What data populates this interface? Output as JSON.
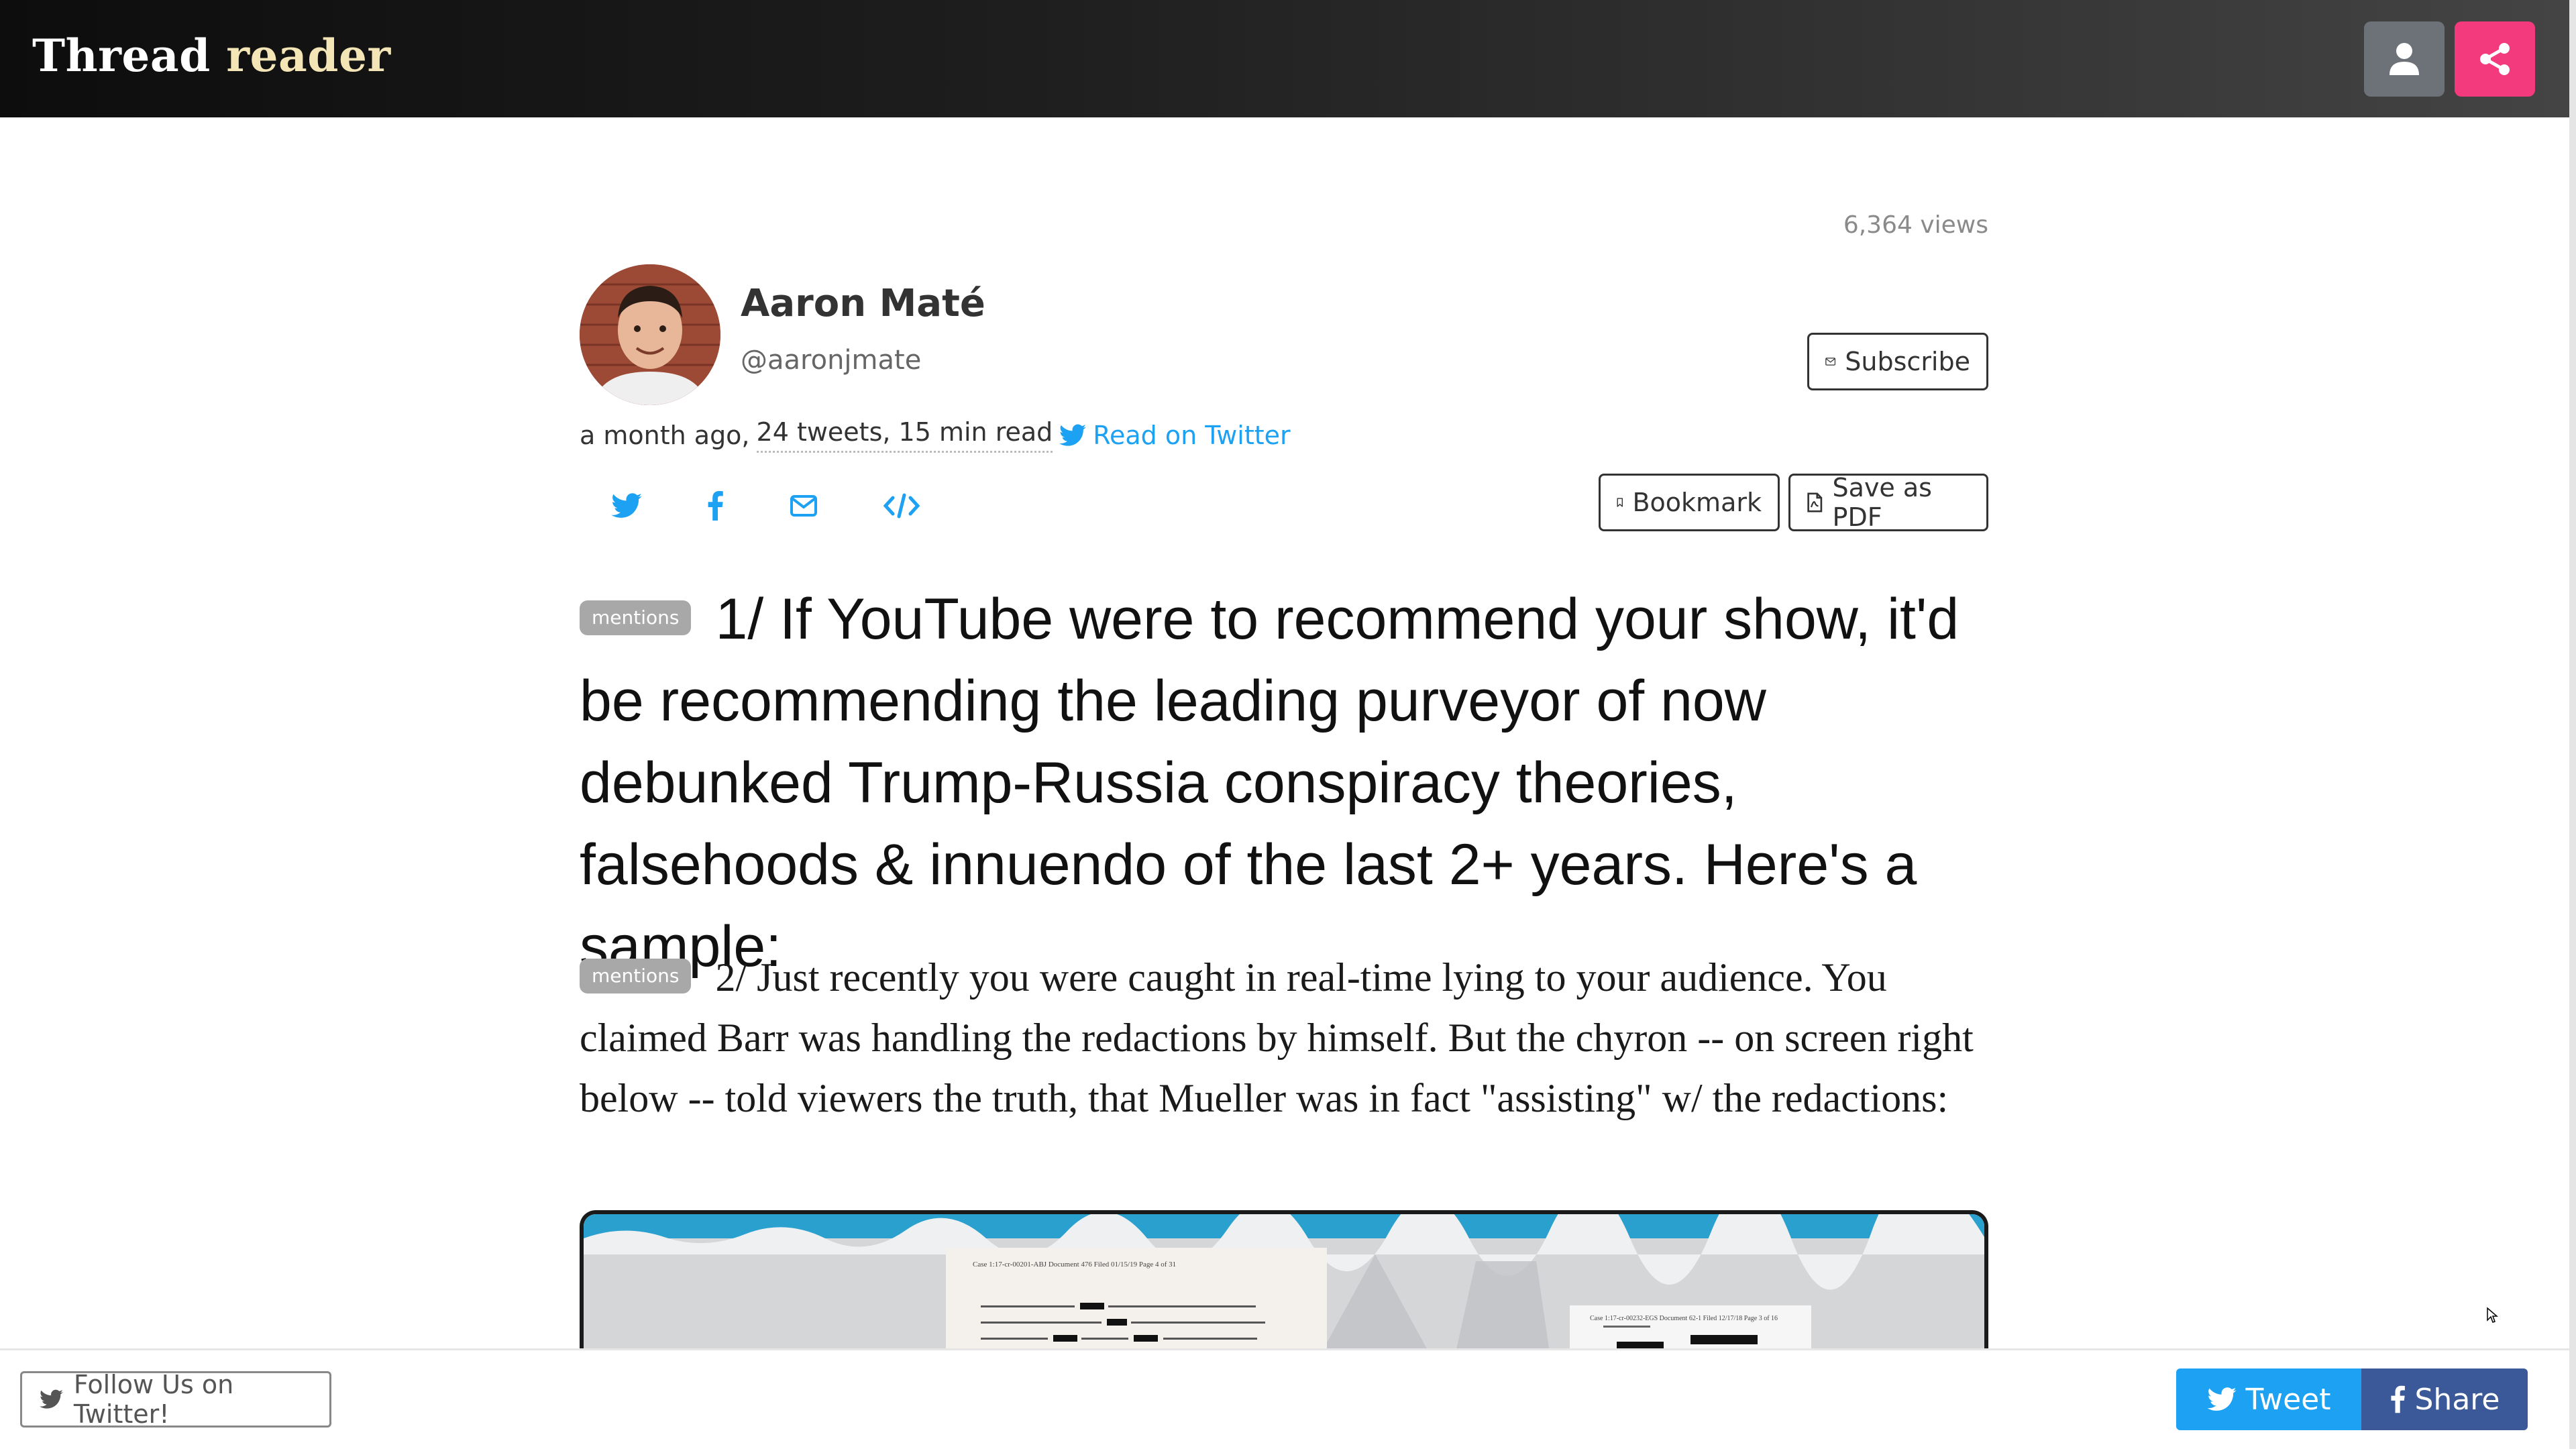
{
  "header": {
    "brand_part1": "Thread",
    "brand_part2": "reader",
    "user_icon": "user-icon",
    "share_icon": "share-icon"
  },
  "stats": {
    "views": "6,364 views"
  },
  "author": {
    "name": "Aaron Maté",
    "handle": "@aaronjmate",
    "subscribe_label": "Subscribe"
  },
  "meta": {
    "time_ago": "a month ago,",
    "details": "24 tweets, 15 min read",
    "read_on_twitter": "Read on Twitter"
  },
  "share_icons": [
    "twitter-icon",
    "facebook-icon",
    "email-icon",
    "embed-icon"
  ],
  "actions": {
    "bookmark": "Bookmark",
    "save_pdf": "Save as PDF"
  },
  "tweets": [
    {
      "badge": "mentions",
      "text": "1/ If YouTube were to recommend your show, it'd be recommending the leading purveyor of now debunked Trump-Russia conspiracy theories, falsehoods & innuendo of the last 2+ years. Here's a sample:"
    },
    {
      "badge": "mentions",
      "text": "2/ Just recently you were caught in real-time lying to your audience. You claimed Barr was handling the redactions by himself. But the chyron -- on screen right below -- told viewers the truth, that Mueller was in fact \"assisting\" w/ the redactions:"
    }
  ],
  "media": {
    "doc1_header": "Case 1:17-cr-00201-ABJ   Document 476   Filed 01/15/19   Page 4 of 31",
    "doc2_header": "Case 1:17-cr-00232-EGS   Document 62-1   Filed 12/17/18   Page 3 of 16"
  },
  "footer": {
    "follow_label": "Follow Us on Twitter!",
    "tweet_label": "Tweet",
    "share_label": "Share"
  },
  "colors": {
    "accent_share": "#f23a7c",
    "twitter_blue": "#1da1f2",
    "facebook_blue": "#3b5998",
    "badge_gray": "#a8a8a8"
  }
}
